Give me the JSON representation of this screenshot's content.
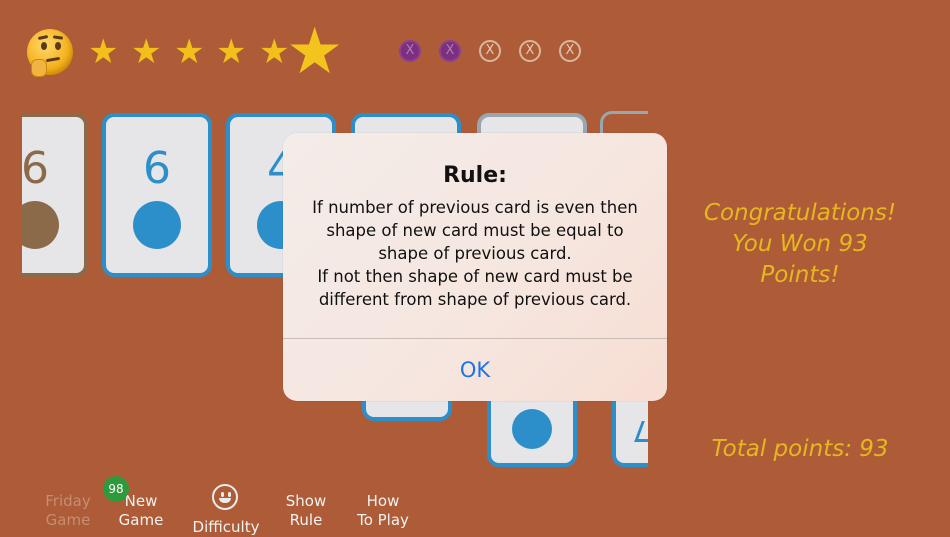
{
  "header": {
    "stars_filled": 6,
    "lives": [
      {
        "symbol": "X",
        "used": true
      },
      {
        "symbol": "X",
        "used": true
      },
      {
        "symbol": "X",
        "used": false
      },
      {
        "symbol": "X",
        "used": false
      },
      {
        "symbol": "X",
        "used": false
      }
    ]
  },
  "cards": [
    {
      "number": "6",
      "shape": "circle"
    },
    {
      "number": "6",
      "shape": "circle"
    },
    {
      "number": "4",
      "shape": "circle"
    }
  ],
  "status": {
    "congrats_line1": "Congratulations!",
    "congrats_line2": "You Won 93 Points!",
    "total_points": "Total points: 93"
  },
  "toolbar": {
    "friday_game_line1": "Friday",
    "friday_game_line2": "Game",
    "new_game_badge": "98",
    "new_game_line1": "New",
    "new_game_line2": "Game",
    "difficulty": "Difficulty",
    "show_rule_line1": "Show",
    "show_rule_line2": "Rule",
    "how_to_play_line1": "How",
    "how_to_play_line2": "To Play"
  },
  "dialog": {
    "title": "Rule:",
    "message": "If number of previous card is even then shape of new card must be equal to shape of previous card.\n If not then shape of new card must be different from shape of previous card.",
    "ok_label": "OK"
  },
  "colors": {
    "background": "#ad5c37",
    "card_accent": "#2d8fca",
    "gold": "#e7b71f",
    "life_used": "#7b2f7f",
    "ok_blue": "#1a76e6"
  }
}
